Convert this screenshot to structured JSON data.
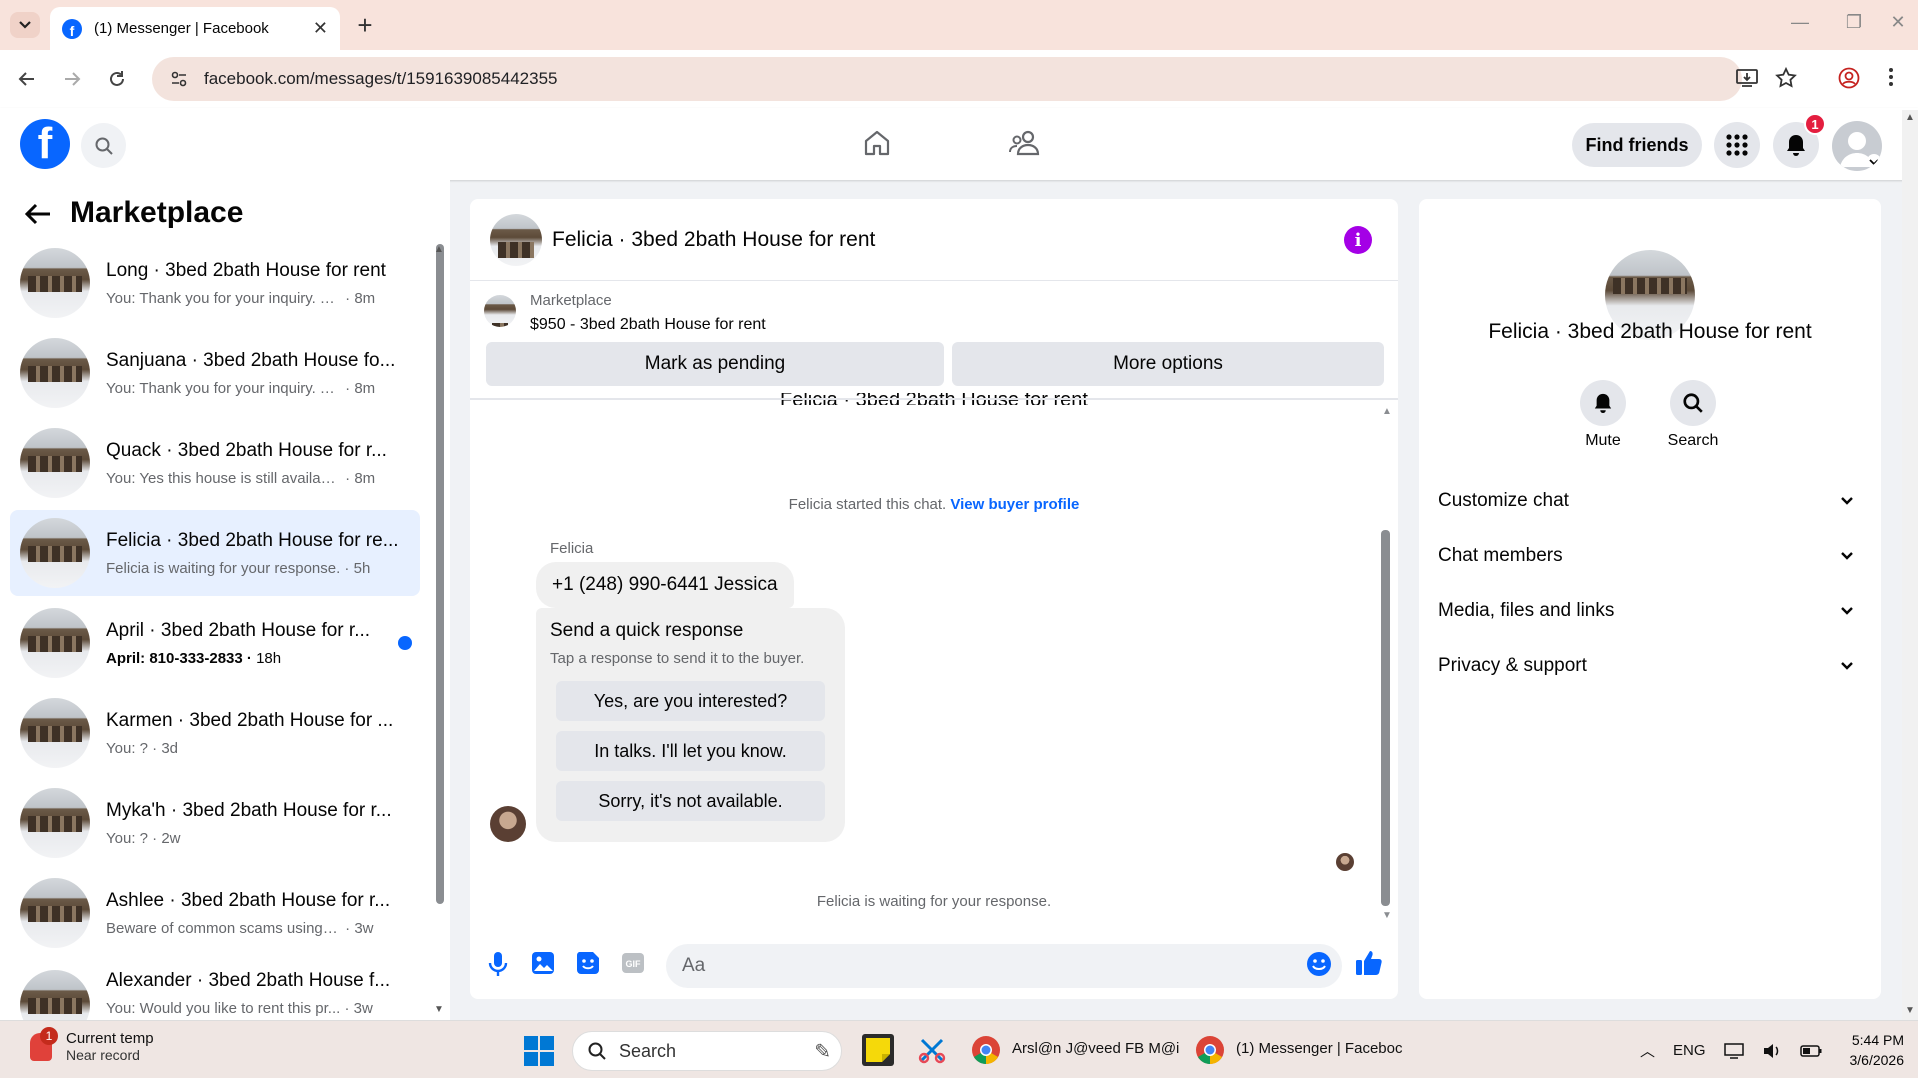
{
  "browser": {
    "tab_title": "(1) Messenger | Facebook",
    "url": "facebook.com/messages/t/1591639085442355"
  },
  "header": {
    "find_friends": "Find friends",
    "notification_count": "1"
  },
  "marketplace": {
    "title": "Marketplace",
    "conversations": [
      {
        "name": "Long · 3bed 2bath House for rent",
        "snippet": "You: Thank you for your inquiry. Th...",
        "time": "8m",
        "unread": false
      },
      {
        "name": "Sanjuana · 3bed 2bath House fo...",
        "snippet": "You: Thank you for your inquiry. Th...",
        "time": "8m",
        "unread": false
      },
      {
        "name": "Quack · 3bed 2bath House for r...",
        "snippet": "You: Yes this house is still available ...",
        "time": "8m",
        "unread": false
      },
      {
        "name": "Felicia · 3bed 2bath House for re...",
        "snippet": "Felicia is waiting for your response.",
        "time": "5h",
        "unread": false
      },
      {
        "name": "April · 3bed 2bath House for r...",
        "snippet": "April: 810-333-2833",
        "time": "18h",
        "unread": true
      },
      {
        "name": "Karmen · 3bed 2bath House for ...",
        "snippet": "You: ?",
        "time": "3d",
        "unread": false
      },
      {
        "name": "Myka'h · 3bed 2bath House for r...",
        "snippet": "You: ?",
        "time": "2w",
        "unread": false
      },
      {
        "name": "Ashlee · 3bed 2bath House for r...",
        "snippet": "Beware of common scams using p...",
        "time": "3w",
        "unread": false
      },
      {
        "name": "Alexander · 3bed 2bath House f...",
        "snippet": "You: Would you like to rent this pr...",
        "time": "3w",
        "unread": false
      }
    ]
  },
  "chat": {
    "title": "Felicia · 3bed 2bath House for rent",
    "listing_label": "Marketplace",
    "listing_title": "$950 - 3bed 2bath House for rent",
    "mark_pending": "Mark as pending",
    "more_options": "More options",
    "started_text": "Felicia started this chat.",
    "view_profile": "View buyer profile",
    "sender": "Felicia",
    "message": "+1 (248) 990-6441 Jessica",
    "quick_title": "Send a quick response",
    "quick_sub": "Tap a response to send it to the buyer.",
    "quick_options": [
      "Yes, are you interested?",
      "In talks. I'll let you know.",
      "Sorry, it's not available."
    ],
    "waiting": "Felicia is waiting for your response.",
    "composer_placeholder": "Aa"
  },
  "details": {
    "name": "Felicia · 3bed 2bath House for rent",
    "mute": "Mute",
    "search": "Search",
    "sections": [
      "Customize chat",
      "Chat members",
      "Media, files and links",
      "Privacy & support"
    ]
  },
  "taskbar": {
    "weather_title": "Current temp",
    "weather_sub": "Near record",
    "weather_badge": "1",
    "search": "Search",
    "app1": "Arsl@n J@veed FB M@i",
    "app2": "(1) Messenger | Faceboc",
    "lang": "ENG",
    "time": "5:44 PM",
    "date": "3/6/2026"
  },
  "colors": {
    "fb_blue": "#0866ff",
    "messenger_purple": "#a400e6",
    "active_row": "#e7f0ff",
    "tab_bar": "#f8e3dc"
  }
}
